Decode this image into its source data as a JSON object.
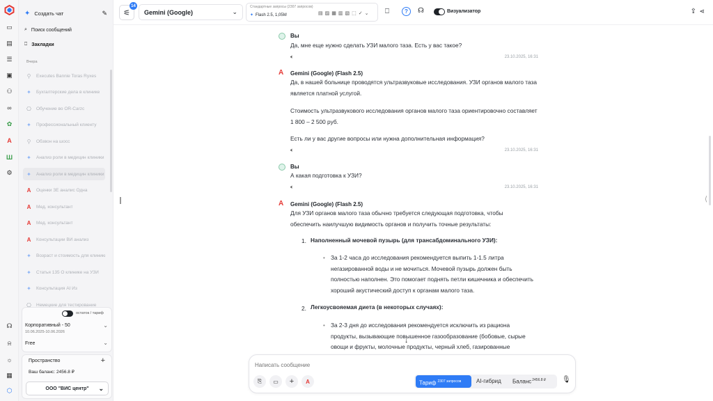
{
  "sidebar": {
    "new_chat": "Создать чат",
    "search": "Поиск сообщений",
    "bookmarks": "Закладки",
    "group_label": "Вчера",
    "chats": [
      {
        "icon": "robot-icon",
        "title": "Executes Bannie Toras Ryxes"
      },
      {
        "icon": "gemini-icon",
        "title": "Бухгалтерские дела в клинике"
      },
      {
        "icon": "openai-icon",
        "title": "Обучение во OR-Carzc"
      },
      {
        "icon": "gemini-icon",
        "title": "Профессиональный клиенту"
      },
      {
        "icon": "robot-icon",
        "title": "Обзвон на шосс"
      },
      {
        "icon": "gemini-icon",
        "title": "Анализ роли в медицин клиники"
      },
      {
        "icon": "gemini-icon",
        "title": "Анализ роли в медицин клиники"
      },
      {
        "icon": "anthropic-icon",
        "title": "Оценки ЗЕ аналис Одна"
      },
      {
        "icon": "anthropic-icon",
        "title": "Мед. консультант"
      },
      {
        "icon": "anthropic-icon",
        "title": "Мед. консультант"
      },
      {
        "icon": "anthropic-icon",
        "title": "Консультации ВИ анализ"
      },
      {
        "icon": "gemini-icon",
        "title": "Возраст и стоимость для клиники"
      },
      {
        "icon": "gemini-icon",
        "title": "Статья 135 О клинике на УЗИ"
      },
      {
        "icon": "gemini-icon",
        "title": "Консультация АI Из"
      },
      {
        "icon": "openai-icon",
        "title": "Немецкие для тестирование"
      },
      {
        "icon": "gemini-icon",
        "title": "Консультация АI в клинику"
      }
    ],
    "toggle_label": "остаток / тариф",
    "plan_name": "Корпоративный - 50",
    "plan_dates": "10.06.2025-10.06.2026",
    "free_label": "Free",
    "space_title": "Пространство",
    "balance_label": "Ваш баланс: 2456.8 ₽",
    "org_name": "ООО \"ВИС центр\""
  },
  "header": {
    "badge_count": "14",
    "model": "Gemini (Google)",
    "requests_caption": "Стандартные запросы (2307 запросов)",
    "model_variant": "Flash 2.5, 1,05M",
    "visualizer_label": "Визуализатор"
  },
  "messages": [
    {
      "author": "Вы",
      "text": "Да, мне еще нужно сделать УЗИ малого таза. Есть у вас такое?",
      "time": "23.10.2025, 16:31"
    },
    {
      "author": "Gemini (Google) (Flash 2.5)",
      "p1": "Да, в нашей больнице проводятся ультразвуковые исследования. УЗИ органов малого таза является платной услугой.",
      "p2": "Стоимость ультразвукового исследования органов малого таза ориентировочно составляет 1 800 – 2 500 руб.",
      "p3": "Есть ли у вас другие вопросы или нужна дополнительная информация?",
      "time": "23.10.2025, 16:31"
    },
    {
      "author": "Вы",
      "text": "А какая подготовка к УЗИ?",
      "time": "23.10.2025, 16:31"
    },
    {
      "author": "Gemini (Google) (Flash 2.5)",
      "intro": "Для УЗИ органов малого таза обычно требуется следующая подготовка, чтобы обеспечить наилучшую видимость органов и получить точные результаты:",
      "item1_title": "Наполненный мочевой пузырь (для трансабдоминального УЗИ):",
      "item1_text": "За 1-2 часа до исследования рекомендуется выпить 1-1.5 литра негазированной воды и не мочиться. Мочевой пузырь должен быть полностью наполнен. Это помогает поднять петли кишечника и обеспечить хороший акустический доступ к органам малого таза.",
      "item2_title": "Легкоусвояемая диета (в некоторых случаях):",
      "item2_text": "За 2-3 дня до исследования рекомендуется исключить из рациона продукты, вызывающие повышенное газообразование (бобовые, сырые овощи и фрукты, молочные продукты, черный хлеб, газированные"
    }
  ],
  "composer": {
    "placeholder": "Написать сообщение",
    "tariff_label": "Тариф",
    "tariff_sup": "2307 запросов",
    "hybrid_label": "AI-гибрид",
    "balance_label": "Баланс",
    "balance_sup": "2456.8 ₽"
  },
  "colors": {
    "accent": "#2f7cf6",
    "brand_red": "#e53935"
  }
}
